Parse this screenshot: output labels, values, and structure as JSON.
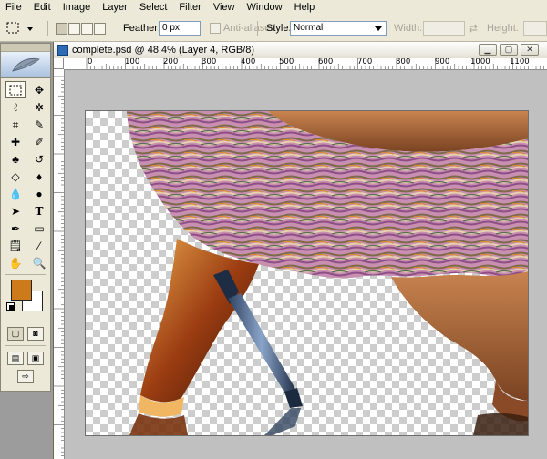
{
  "menu": [
    "File",
    "Edit",
    "Image",
    "Layer",
    "Select",
    "Filter",
    "View",
    "Window",
    "Help"
  ],
  "options": {
    "feather_label": "Feather:",
    "feather_value": "0 px",
    "antialias_label": "Anti-aliased",
    "style_label": "Style:",
    "style_value": "Normal",
    "width_label": "Width:",
    "height_label": "Height:"
  },
  "document": {
    "title": "complete.psd @ 48.4% (Layer 4, RGB/8)",
    "ruler_labels": [
      "0",
      "100",
      "200",
      "300",
      "400",
      "500",
      "600",
      "700",
      "800",
      "900",
      "1000",
      "1100"
    ]
  },
  "colors": {
    "foreground": "#cc7a1a",
    "background": "#ffffff"
  },
  "icons": {
    "tools": [
      "rectangular-marquee",
      "move",
      "lasso",
      "magic-wand",
      "crop",
      "slice",
      "healing-brush",
      "brush",
      "clone-stamp",
      "history-brush",
      "eraser",
      "paint-bucket",
      "blur",
      "dodge",
      "path-selection",
      "type",
      "pen",
      "shape",
      "notes",
      "eyedropper",
      "hand",
      "zoom"
    ]
  }
}
